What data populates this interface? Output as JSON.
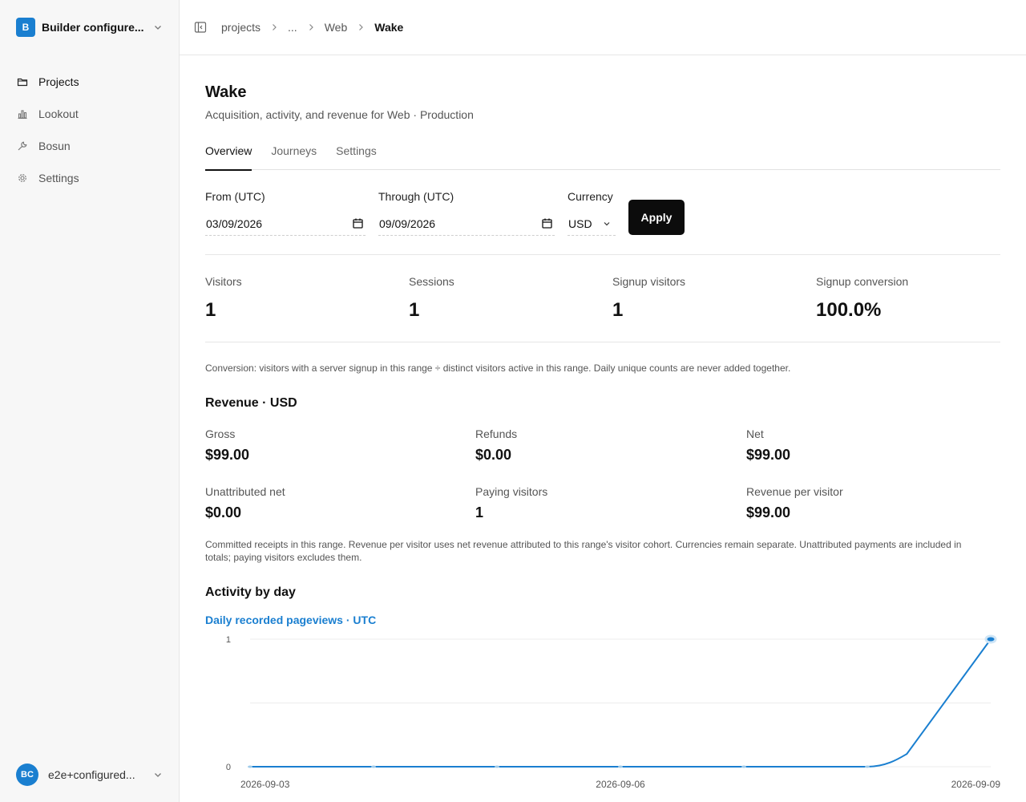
{
  "sidebar": {
    "workspace": {
      "initial": "B",
      "name": "Builder configure..."
    },
    "nav": [
      {
        "label": "Projects",
        "icon": "folder-icon"
      },
      {
        "label": "Lookout",
        "icon": "bar-chart-icon"
      },
      {
        "label": "Bosun",
        "icon": "wrench-icon"
      },
      {
        "label": "Settings",
        "icon": "gear-icon"
      }
    ],
    "user": {
      "initials": "BC",
      "name": "e2e+configured..."
    }
  },
  "breadcrumb": [
    "projects",
    "...",
    "Web",
    "Wake"
  ],
  "page": {
    "title": "Wake",
    "subtitle": "Acquisition, activity, and revenue for Web · Production"
  },
  "tabs": [
    "Overview",
    "Journeys",
    "Settings"
  ],
  "filters": {
    "from_label": "From (UTC)",
    "from_value": "03/09/2026",
    "through_label": "Through (UTC)",
    "through_value": "09/09/2026",
    "currency_label": "Currency",
    "currency_value": "USD",
    "apply_label": "Apply"
  },
  "stats": [
    {
      "label": "Visitors",
      "value": "1"
    },
    {
      "label": "Sessions",
      "value": "1"
    },
    {
      "label": "Signup visitors",
      "value": "1"
    },
    {
      "label": "Signup conversion",
      "value": "100.0%"
    }
  ],
  "conversion_note": "Conversion: visitors with a server signup in this range ÷ distinct visitors active in this range. Daily unique counts are never added together.",
  "revenue": {
    "title": "Revenue · USD",
    "items": [
      {
        "label": "Gross",
        "value": "$99.00"
      },
      {
        "label": "Refunds",
        "value": "$0.00"
      },
      {
        "label": "Net",
        "value": "$99.00"
      },
      {
        "label": "Unattributed net",
        "value": "$0.00"
      },
      {
        "label": "Paying visitors",
        "value": "1"
      },
      {
        "label": "Revenue per visitor",
        "value": "$99.00"
      }
    ],
    "note": "Committed receipts in this range. Revenue per visitor uses net revenue attributed to this range's visitor cohort. Currencies remain separate. Unattributed payments are included in totals; paying visitors excludes them."
  },
  "activity": {
    "title": "Activity by day",
    "chart_title": "Daily recorded pageviews · UTC"
  },
  "colors": {
    "accent": "#1a7fd0",
    "primary_button": "#0c0c0c"
  },
  "chart_data": {
    "type": "line",
    "title": "Daily recorded pageviews · UTC",
    "x": [
      "2026-09-03",
      "2026-09-04",
      "2026-09-05",
      "2026-09-06",
      "2026-09-07",
      "2026-09-08",
      "2026-09-09"
    ],
    "series": [
      {
        "values": [
          0,
          0,
          0,
          0,
          0,
          0,
          1
        ]
      }
    ],
    "x_tick_labels": [
      "2026-09-03",
      "2026-09-06",
      "2026-09-09"
    ],
    "y_tick_labels": [
      "0",
      "1"
    ],
    "ylim": [
      0,
      1
    ],
    "grid": true,
    "xlabel": "",
    "ylabel": ""
  }
}
